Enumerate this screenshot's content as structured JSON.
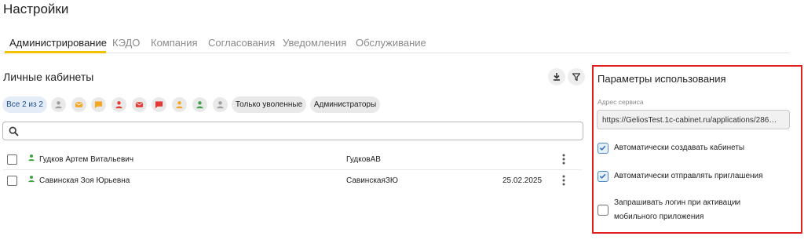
{
  "page": {
    "title": "Настройки"
  },
  "tabs": [
    {
      "label": "Администрирование",
      "active": true
    },
    {
      "label": "КЭДО"
    },
    {
      "label": "Компания"
    },
    {
      "label": "Согласования"
    },
    {
      "label": "Уведомления"
    },
    {
      "label": "Обслуживание"
    }
  ],
  "cabinets": {
    "title": "Личные кабинеты",
    "toolbar": {
      "download_icon": "download-icon",
      "filter_icon": "filter-icon"
    },
    "filters": {
      "all_chip": "Все 2 из 2",
      "icon_chips": [
        {
          "icon": "person-icon",
          "color": "#9e9e9e"
        },
        {
          "icon": "mail-icon",
          "color": "#f5a623"
        },
        {
          "icon": "chat-icon",
          "color": "#f5a623"
        },
        {
          "icon": "person-icon",
          "color": "#e53935"
        },
        {
          "icon": "mail-icon",
          "color": "#e53935"
        },
        {
          "icon": "chat-icon",
          "color": "#e53935"
        },
        {
          "icon": "person-icon",
          "color": "#f5a623"
        },
        {
          "icon": "person-icon",
          "color": "#43a047"
        },
        {
          "icon": "person-icon",
          "color": "#9e9e9e"
        }
      ],
      "fired_only": "Только уволенные",
      "admins": "Администраторы"
    },
    "search": {
      "value": "",
      "placeholder": ""
    },
    "rows": [
      {
        "name": "Гудков Артем Витальевич",
        "login": "ГудковАВ",
        "date": "",
        "status_color": "#43a047"
      },
      {
        "name": "Савинская Зоя Юрьевна",
        "login": "СавинскаяЗЮ",
        "date": "25.02.2025",
        "status_color": "#43a047"
      }
    ]
  },
  "params": {
    "title": "Параметры использования",
    "service_address_label": "Адрес сервиса",
    "service_address_value": "https://GeliosTest.1c-cabinet.ru/applications/286…",
    "options": [
      {
        "label_lines": [
          "Автоматически создавать кабинеты"
        ],
        "checked": true
      },
      {
        "label_lines": [
          "Автоматически отправлять приглашения"
        ],
        "checked": true
      },
      {
        "label_lines": [
          "Запрашивать логин при активации",
          "мобильного приложения"
        ],
        "checked": false
      }
    ]
  },
  "colors": {
    "accent": "#f2c200",
    "highlight_border": "#e02020",
    "checkbox_checked": "#4a8ad0"
  }
}
